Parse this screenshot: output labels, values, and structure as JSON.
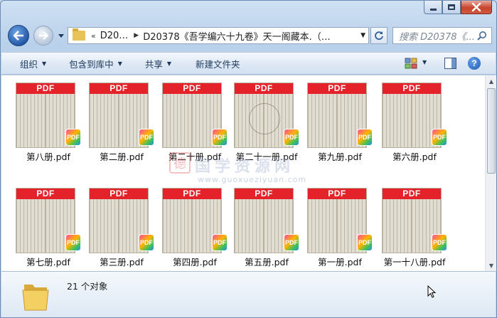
{
  "window": {
    "caption_buttons": [
      "minimize",
      "maximize",
      "close"
    ]
  },
  "nav": {
    "address_chevron": "«",
    "address_segments": [
      "D20…",
      "D20378《吾学编六十九卷》天一阁藏本.（…"
    ],
    "search_placeholder": "搜索 D20378《..."
  },
  "commands": [
    "组织",
    "包含到库中",
    "共享",
    "新建文件夹"
  ],
  "files": [
    {
      "name": "第八册.pdf"
    },
    {
      "name": "第二册.pdf"
    },
    {
      "name": "第二十册.pdf"
    },
    {
      "name": "第二十一册.pdf"
    },
    {
      "name": "第九册.pdf"
    },
    {
      "name": "第六册.pdf"
    },
    {
      "name": "第七册.pdf"
    },
    {
      "name": "第三册.pdf"
    },
    {
      "name": "第四册.pdf"
    },
    {
      "name": "第五册.pdf"
    },
    {
      "name": "第一册.pdf"
    },
    {
      "name": "第一十八册.pdf"
    }
  ],
  "thumb_band_label": "PDF",
  "badge_label": "PDF",
  "watermark": {
    "text": "国学资源网",
    "url": "www.guoxueziyuan.com",
    "seal": "德"
  },
  "status": {
    "count": "21 个对象"
  },
  "colors": {
    "pdf_red": "#e4222a",
    "selection_blue": "#3399ff"
  }
}
